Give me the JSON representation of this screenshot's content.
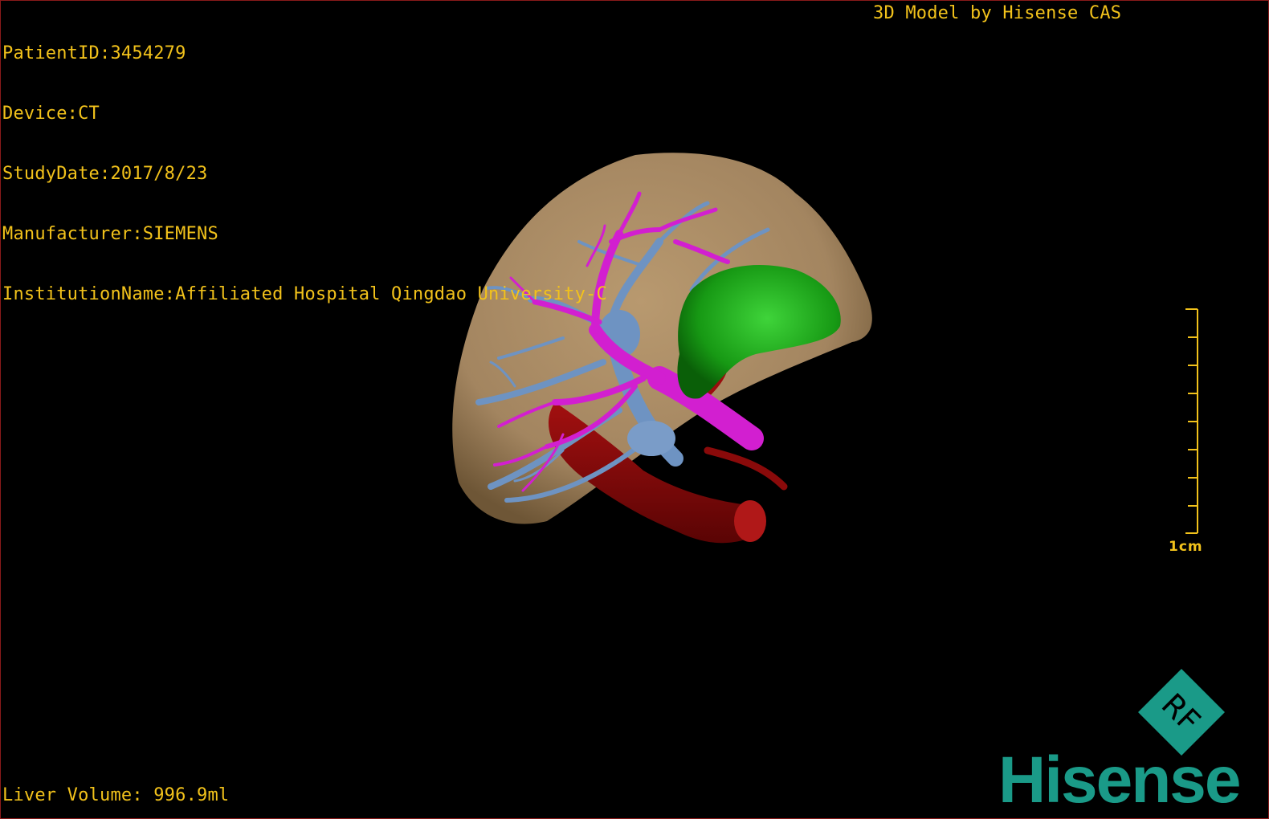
{
  "viewer": {
    "patient_id": "PatientID:3454279",
    "device": "Device:CT",
    "study_date": "StudyDate:2017/8/23",
    "manufacturer": "Manufacturer:SIEMENS",
    "institution": "InstitutionName:Affiliated Hospital Qingdao University-C",
    "model_credit": "3D Model by Hisense CAS",
    "liver_volume": "Liver Volume: 996.9ml",
    "scale_bar_label": "1cm"
  },
  "logo": {
    "badge_text": "RF",
    "brand_text": "Hisense",
    "brand_color": "#1a9a88"
  },
  "model": {
    "structures": [
      "liver-surface",
      "portal-vein",
      "hepatic-vein",
      "tumor",
      "inferior-vena-cava"
    ],
    "colors": {
      "liver": "#a88a63",
      "portal_vein": "#d21fd0",
      "hepatic_vein": "#6e93c2",
      "tumor": "#1fa31a",
      "vena_cava": "#8a0a0a"
    }
  },
  "colors": {
    "overlay_text": "#f2c21b",
    "background": "#000000",
    "border": "#8a1a1a"
  }
}
